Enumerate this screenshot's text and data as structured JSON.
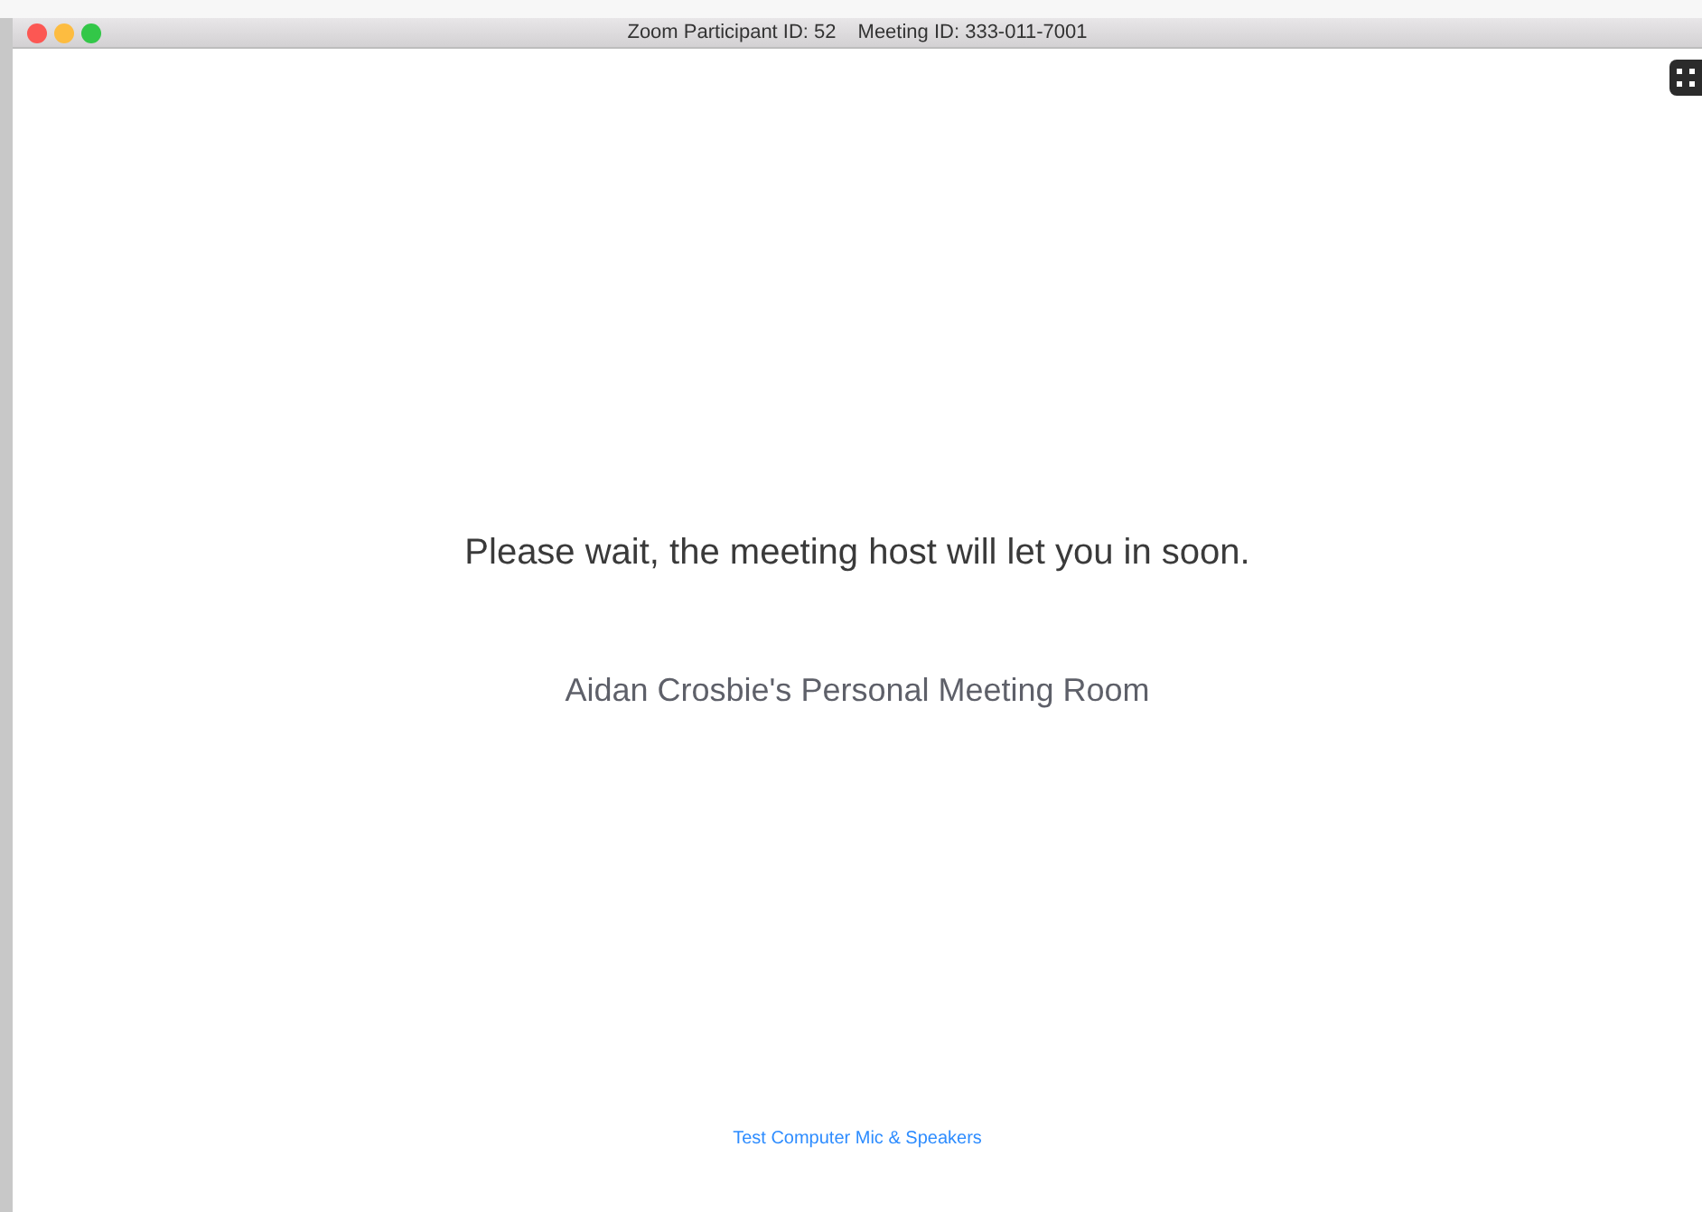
{
  "window": {
    "title_parts": [
      "Zoom Participant ID: 52",
      "Meeting ID: 333-011-7001"
    ]
  },
  "message": "Please wait, the meeting host will let you in soon.",
  "room_name": "Aidan Crosbie's Personal Meeting Room",
  "test_link": "Test Computer Mic & Speakers"
}
